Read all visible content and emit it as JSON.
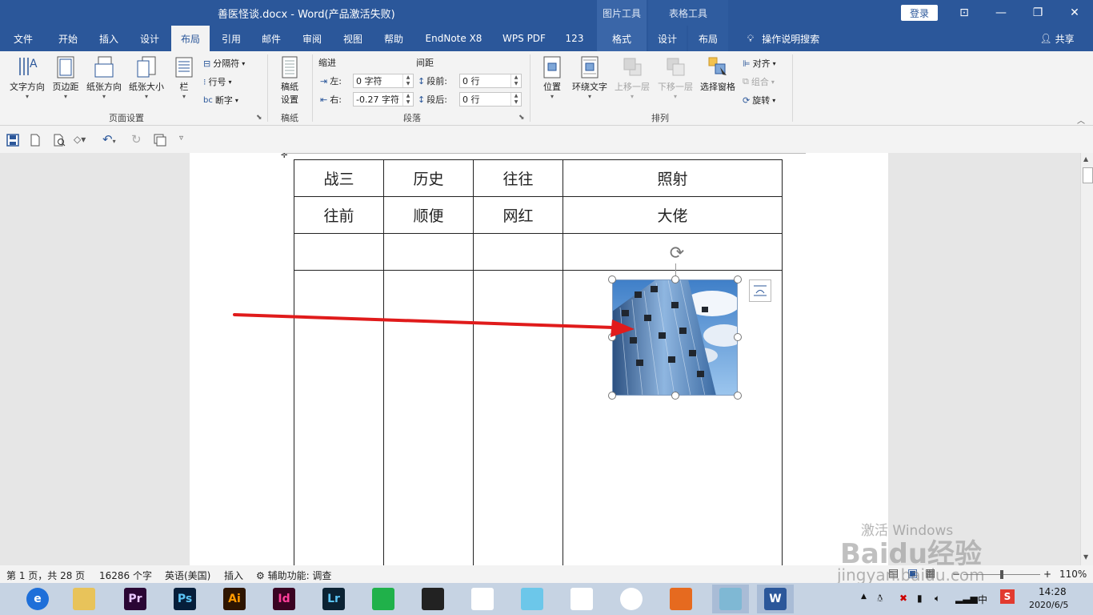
{
  "window": {
    "title": "善医怪谈.docx  -  Word(产品激活失败)",
    "context_headers": [
      "图片工具",
      "表格工具"
    ],
    "login_label": "登录",
    "controls": {
      "restore_ribbon": "⊡",
      "minimize": "—",
      "maximize": "❐",
      "close": "✕"
    }
  },
  "tabs": {
    "file": "文件",
    "home": "开始",
    "insert": "插入",
    "design": "设计",
    "layout": "布局",
    "references": "引用",
    "mailings": "邮件",
    "review": "审阅",
    "view": "视图",
    "help": "帮助",
    "endnote": "EndNote X8",
    "wpspdf": "WPS PDF",
    "n123": "123",
    "pic_format": "格式",
    "tbl_design": "设计",
    "tbl_layout": "布局",
    "tell_me": "操作说明搜索",
    "share": "共享"
  },
  "ribbon": {
    "page_setup": {
      "label": "页面设置",
      "text_direction": "文字方向",
      "margins": "页边距",
      "orientation": "纸张方向",
      "size": "纸张大小",
      "columns": "栏",
      "breaks": "分隔符",
      "line_numbers": "行号",
      "hyphenation": "断字"
    },
    "manuscript": {
      "label": "稿纸",
      "setup_line1": "稿纸",
      "setup_line2": "设置"
    },
    "paragraph": {
      "label": "段落",
      "indent_title": "缩进",
      "spacing_title": "间距",
      "left_label": "左:",
      "left_value": "0 字符",
      "right_label": "右:",
      "right_value": "-0.27 字符",
      "before_label": "段前:",
      "before_value": "0 行",
      "after_label": "段后:",
      "after_value": "0 行"
    },
    "arrange": {
      "label": "排列",
      "position": "位置",
      "wrap_text": "环绕文字",
      "bring_forward": "上移一层",
      "send_backward": "下移一层",
      "selection_pane": "选择窗格",
      "align": "对齐",
      "group": "组合",
      "rotate": "旋转"
    }
  },
  "table": {
    "rows": [
      [
        "战三",
        "历史",
        "往往",
        "照射"
      ],
      [
        "往前",
        "顺便",
        "网红",
        "大佬"
      ],
      [
        "",
        "",
        "",
        ""
      ],
      [
        "",
        "",
        "",
        ""
      ]
    ]
  },
  "status": {
    "page": "第 1 页，共 28 页",
    "words": "16286 个字",
    "language": "英语(美国)",
    "mode": "插入",
    "accessibility": "辅助功能: 调查",
    "zoom": "110%",
    "zoom_minus": "−",
    "zoom_plus": "+"
  },
  "taskbar": {
    "apps": [
      {
        "name": "edge",
        "label": "e",
        "color": "#1e6fd9"
      },
      {
        "name": "explorer",
        "label": "",
        "color": "#e8c35a"
      },
      {
        "name": "premiere",
        "label": "Pr",
        "color": "#2a0634"
      },
      {
        "name": "photoshop",
        "label": "Ps",
        "color": "#061e3a"
      },
      {
        "name": "illustrator",
        "label": "Ai",
        "color": "#2e1500"
      },
      {
        "name": "indesign",
        "label": "Id",
        "color": "#3a0322"
      },
      {
        "name": "lightroom",
        "label": "Lr",
        "color": "#0b2233"
      },
      {
        "name": "green-app",
        "label": "",
        "color": "#20b14a"
      },
      {
        "name": "video-app",
        "label": "",
        "color": "#222222"
      },
      {
        "name": "umbrella-app",
        "label": "",
        "color": "#ffffff"
      },
      {
        "name": "cat-app",
        "label": "",
        "color": "#6cc7ea"
      },
      {
        "name": "qq",
        "label": "",
        "color": "#ffffff"
      },
      {
        "name": "chrome",
        "label": "",
        "color": "#ffffff"
      },
      {
        "name": "firefox",
        "label": "",
        "color": "#e66a1f"
      },
      {
        "name": "notes-app",
        "label": "",
        "color": "#7fb8d4"
      },
      {
        "name": "word",
        "label": "W",
        "color": "#2b579a"
      }
    ],
    "ime": "中",
    "time": "14:28",
    "date": "2020/6/5"
  },
  "watermark": {
    "line1": "激活 Windows",
    "line2": "Baidu经验",
    "line3": "jingyan.baidu.com"
  },
  "colors": {
    "accent": "#2b579a",
    "arrow": "#e01b1b",
    "sky": "#3f7fc8"
  }
}
